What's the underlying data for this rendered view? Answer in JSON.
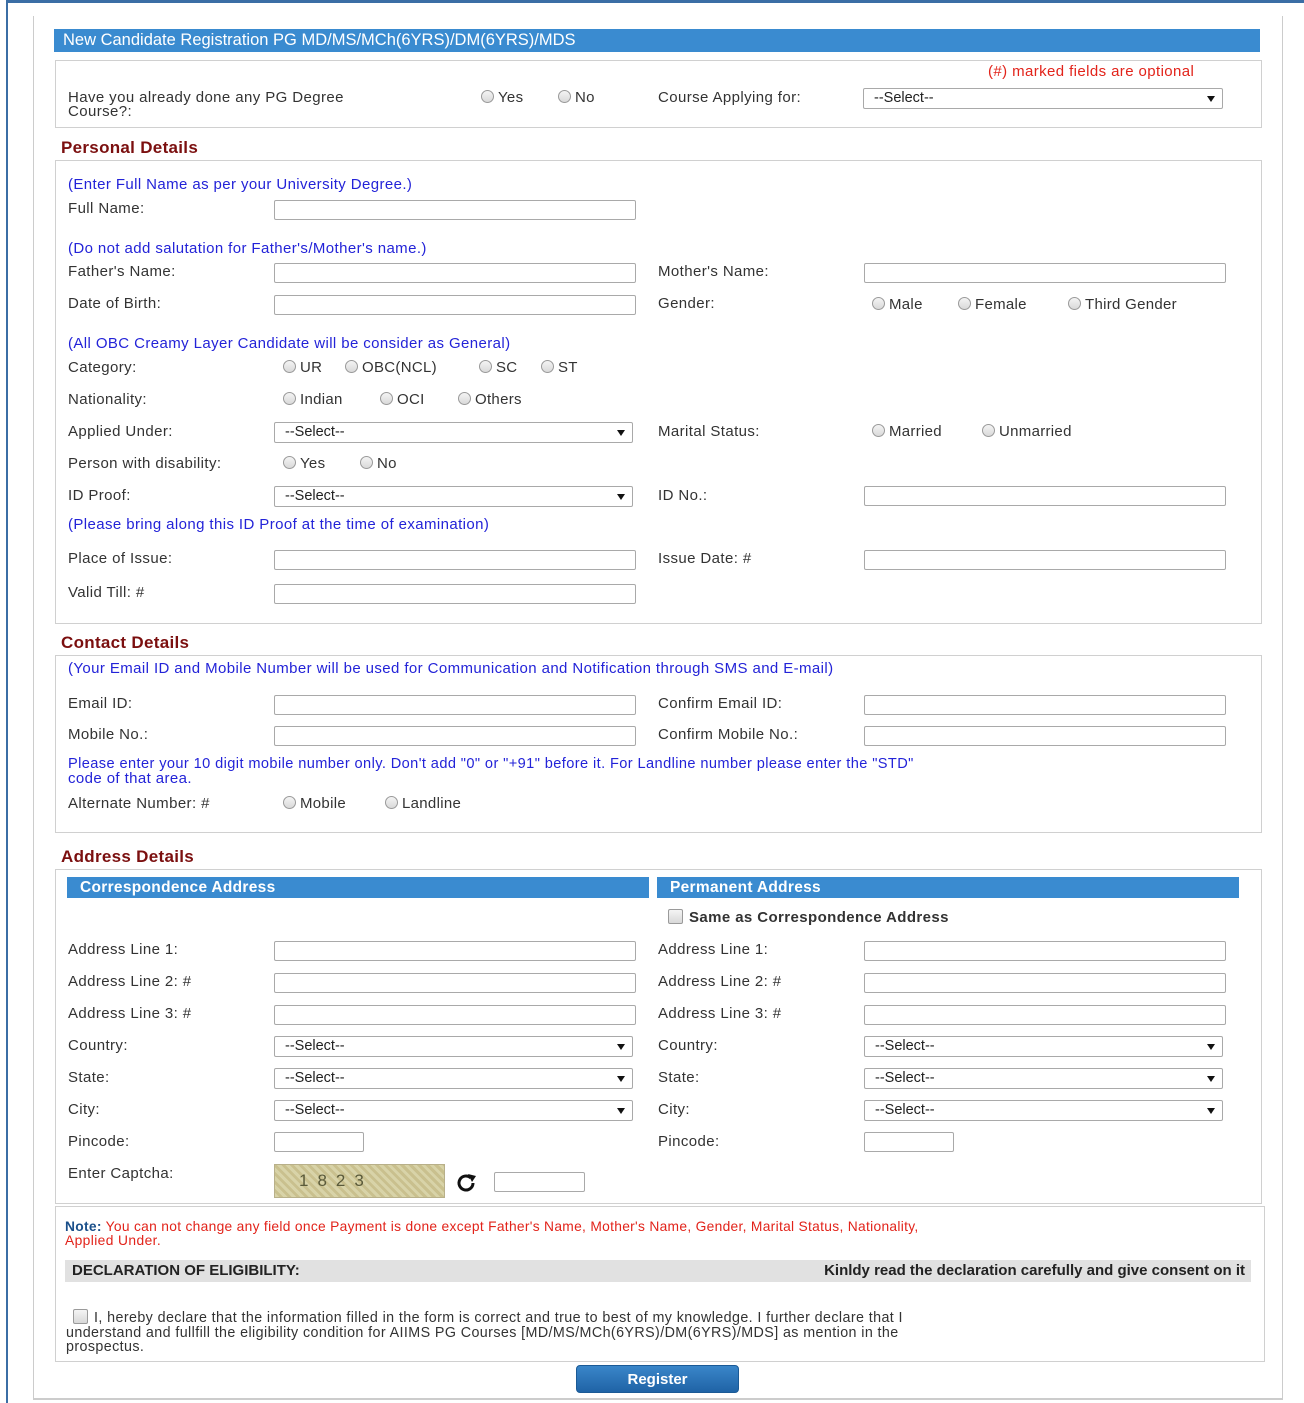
{
  "title": "New Candidate Registration PG MD/MS/MCh(6YRS)/DM(6YRS)/MDS",
  "optional_note": "(#) marked fields are optional",
  "pg_question": {
    "label_line1": "Have you already done any PG Degree",
    "label_line2": "Course?:",
    "opt_yes": "Yes",
    "opt_no": "No"
  },
  "course": {
    "label": "Course Applying for:",
    "value": "--Select--"
  },
  "personal": {
    "heading": "Personal Details",
    "hint_name": "(Enter Full Name as per your University Degree.)",
    "full_name": "Full Name:",
    "hint_salutation": "(Do not add salutation for Father's/Mother's name.)",
    "father": "Father's Name:",
    "mother": "Mother's Name:",
    "dob": "Date of Birth:",
    "gender": "Gender:",
    "gender_male": "Male",
    "gender_female": "Female",
    "gender_third": "Third Gender",
    "hint_obc": "(All OBC Creamy Layer Candidate will be consider as General)",
    "category": "Category:",
    "cat_ur": "UR",
    "cat_obc": "OBC(NCL)",
    "cat_sc": "SC",
    "cat_st": "ST",
    "nationality": "Nationality:",
    "nat_indian": "Indian",
    "nat_oci": "OCI",
    "nat_others": "Others",
    "applied_under": "Applied Under:",
    "applied_under_value": "--Select--",
    "marital": "Marital Status:",
    "marital_married": "Married",
    "marital_unmarried": "Unmarried",
    "disability": "Person with disability:",
    "dis_yes": "Yes",
    "dis_no": "No",
    "id_proof": "ID Proof:",
    "id_proof_value": "--Select--",
    "id_no": "ID No.:",
    "hint_id": "(Please bring along this ID Proof at the time of examination)",
    "place_issue": "Place of Issue:",
    "issue_date": "Issue Date: #",
    "valid_till": "Valid Till: #"
  },
  "contact": {
    "heading": "Contact Details",
    "hint": "(Your Email ID and Mobile Number will be used for Communication and Notification through SMS and E-mail)",
    "email": "Email ID:",
    "confirm_email": "Confirm Email ID:",
    "mobile": "Mobile No.:",
    "confirm_mobile": "Confirm Mobile No.:",
    "mobile_hint_line1": "Please enter your 10 digit mobile number only. Don't add \"0\" or \"+91\" before it. For Landline number please enter the \"STD\"",
    "mobile_hint_line2": "code of that area.",
    "alternate": "Alternate Number: #",
    "alt_mobile": "Mobile",
    "alt_landline": "Landline"
  },
  "address": {
    "heading": "Address Details",
    "corr_heading": "Correspondence Address",
    "perm_heading": "Permanent Address",
    "same_as": "Same as Correspondence Address",
    "line1": "Address Line 1:",
    "line2": "Address Line 2: #",
    "line3": "Address Line 3: #",
    "country": "Country:",
    "state": "State:",
    "city": "City:",
    "pincode": "Pincode:",
    "select_value": "--Select--",
    "captcha_label": "Enter Captcha:",
    "captcha_text": "1823"
  },
  "note": {
    "prefix": "Note:",
    "line1": " You can not change any field once Payment is done except Father's Name, Mother's Name, Gender, Marital Status, Nationality,",
    "line2": "Applied Under."
  },
  "declaration": {
    "heading": "DECLARATION OF ELIGIBILITY:",
    "instruction": "Kinldy read the declaration carefully and give consent on it",
    "line1": "I, hereby declare that the information filled in the form is correct and true to best of my knowledge. I further declare that I",
    "line2": "understand and fullfill the eligibility condition for AIIMS PG Courses [MD/MS/MCh(6YRS)/DM(6YRS)/MDS] as mention in the",
    "line3": "prospectus."
  },
  "register_button": "Register"
}
